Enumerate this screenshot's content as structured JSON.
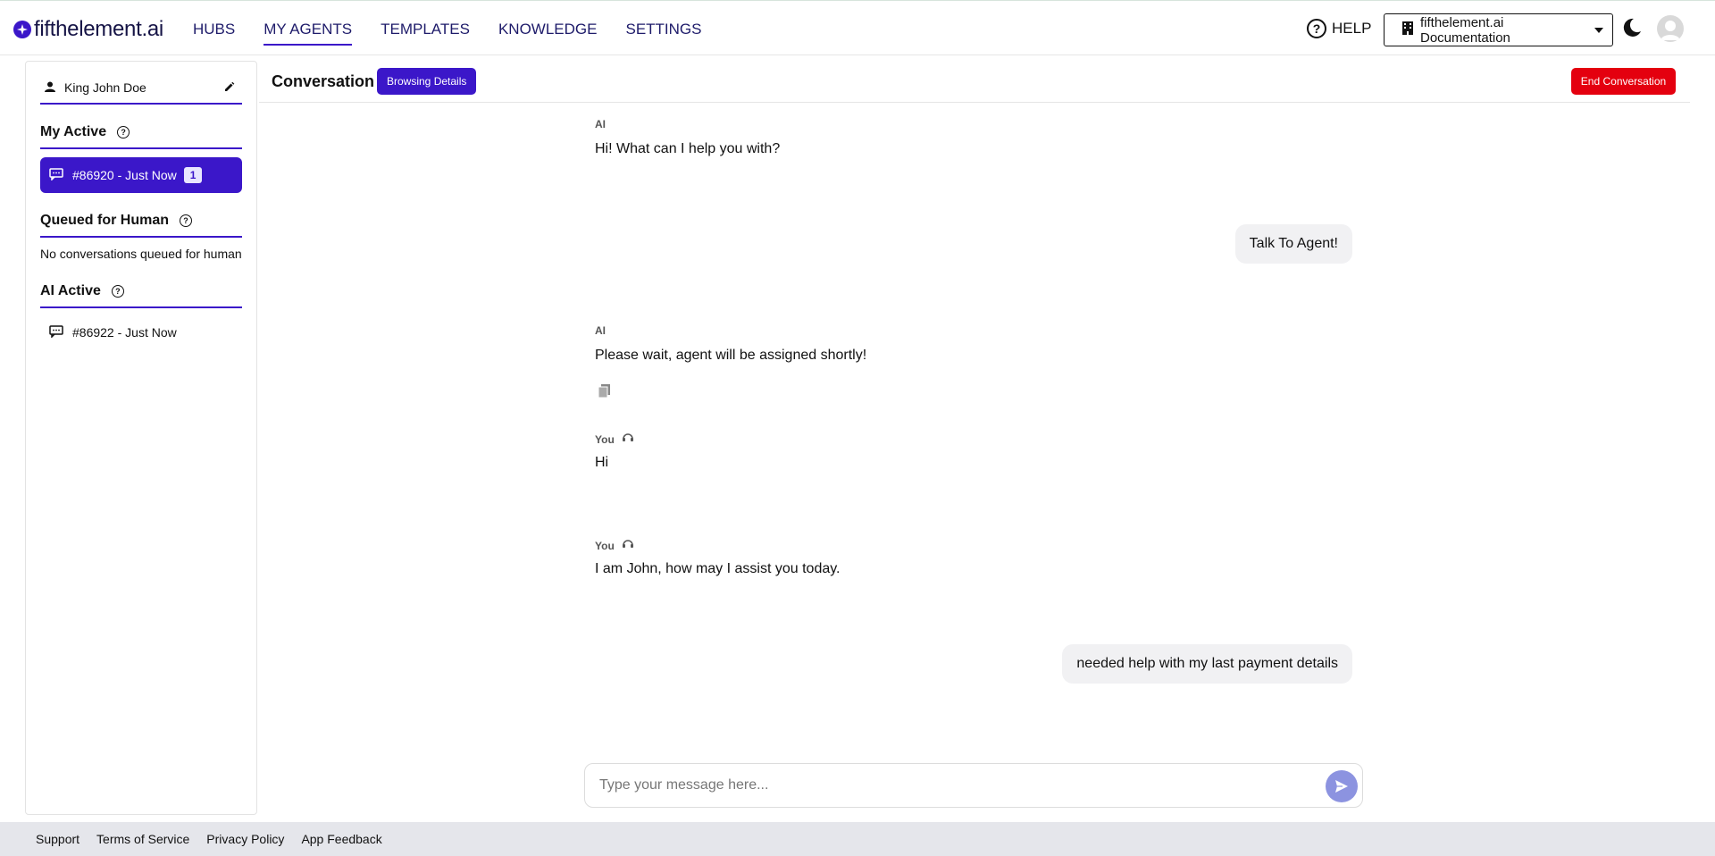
{
  "brand": {
    "name": "fifthelement.ai",
    "accent": "#3b17c9"
  },
  "nav": {
    "items": [
      {
        "label": "HUBS",
        "active": false
      },
      {
        "label": "MY AGENTS",
        "active": true
      },
      {
        "label": "TEMPLATES",
        "active": false
      },
      {
        "label": "KNOWLEDGE",
        "active": false
      },
      {
        "label": "SETTINGS",
        "active": false
      }
    ],
    "help_label": "HELP",
    "workspace": "fifthelement.ai Documentation"
  },
  "sidebar": {
    "user_name": "King John Doe",
    "my_active": {
      "title": "My Active",
      "items": [
        {
          "label": "#86920 - Just Now",
          "badge": "1"
        }
      ]
    },
    "queued": {
      "title": "Queued for Human",
      "empty_text": "No conversations queued for human"
    },
    "ai_active": {
      "title": "AI Active",
      "items": [
        {
          "label": "#86922 - Just Now"
        }
      ]
    }
  },
  "conversation": {
    "title": "Conversation",
    "browsing_button": "Browsing Details",
    "end_button": "End Conversation",
    "end_color": "#e4000f",
    "messages": [
      {
        "sender": "AI",
        "text": "Hi! What can I help you with?"
      },
      {
        "sender": "user",
        "text": "Talk To Agent!"
      },
      {
        "sender": "AI",
        "text": "Please wait, agent will be assigned shortly!"
      },
      {
        "sender": "You",
        "text": "Hi"
      },
      {
        "sender": "You",
        "text": "I am John, how may I assist you today."
      },
      {
        "sender": "user",
        "text": "needed help with my last payment details"
      }
    ],
    "input_placeholder": "Type your message here..."
  },
  "footer": {
    "links": [
      "Support",
      "Terms of Service",
      "Privacy Policy",
      "App Feedback"
    ]
  }
}
